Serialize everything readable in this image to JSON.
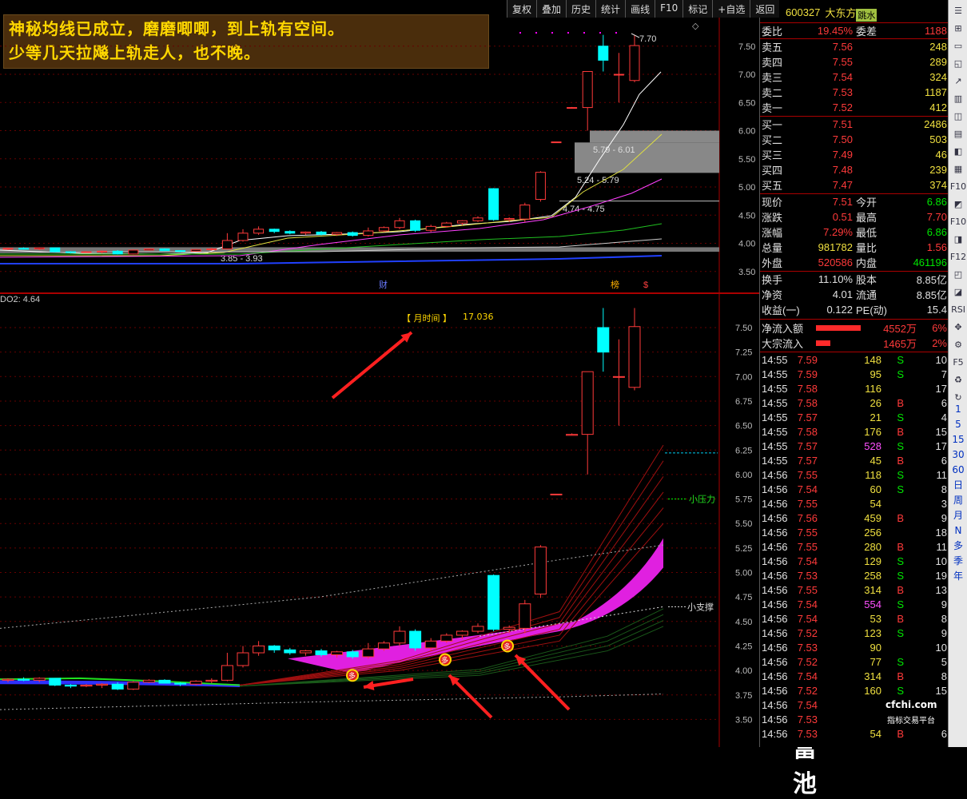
{
  "toolbar": {
    "items": [
      "复权",
      "叠加",
      "历史",
      "统计",
      "画线",
      "F10",
      "标记",
      "+自选",
      "返回"
    ]
  },
  "annotation": {
    "line1": "神秘均线已成立，磨磨唧唧，到上轨有空间。",
    "line2": "少等几天拉飚上轨走人，也不晚。"
  },
  "upper_chart": {
    "y_ticks": [
      "7.50",
      "7.00",
      "6.50",
      "6.00",
      "5.50",
      "5.00",
      "4.50",
      "4.00",
      "3.50"
    ],
    "high_label": "7.70",
    "zone_labels": [
      "5.79 - 6.01",
      "5.24 - 5.79",
      "4.74 - 4.75",
      "3.85 - 3.93"
    ],
    "markers": [
      "财",
      "榜",
      "$"
    ]
  },
  "lower_chart": {
    "indicator": "DO2: 4.64",
    "title": "【 月时间 】",
    "title_value": "17.036",
    "y_ticks": [
      "7.50",
      "7.25",
      "7.00",
      "6.75",
      "6.50",
      "6.25",
      "6.00",
      "5.75",
      "5.50",
      "5.25",
      "5.00",
      "4.75",
      "4.50",
      "4.25",
      "4.00",
      "3.75",
      "3.50"
    ],
    "pressure_label": "小压力",
    "support_label": "小支撑",
    "marker_glyph": "多"
  },
  "quote": {
    "code": "600327",
    "name": "大东方",
    "tag": "跳水",
    "weibi_label": "委比",
    "weibi": "19.45%",
    "weicha_label": "委差",
    "weicha": "1188",
    "sell": [
      {
        "label": "卖五",
        "price": "7.56",
        "vol": "248"
      },
      {
        "label": "卖四",
        "price": "7.55",
        "vol": "289"
      },
      {
        "label": "卖三",
        "price": "7.54",
        "vol": "324"
      },
      {
        "label": "卖二",
        "price": "7.53",
        "vol": "1187"
      },
      {
        "label": "卖一",
        "price": "7.52",
        "vol": "412"
      }
    ],
    "buy": [
      {
        "label": "买一",
        "price": "7.51",
        "vol": "2486"
      },
      {
        "label": "买二",
        "price": "7.50",
        "vol": "503"
      },
      {
        "label": "买三",
        "price": "7.49",
        "vol": "46"
      },
      {
        "label": "买四",
        "price": "7.48",
        "vol": "239"
      },
      {
        "label": "买五",
        "price": "7.47",
        "vol": "374"
      }
    ],
    "stats": [
      {
        "l1": "现价",
        "v1": "7.51",
        "l2": "今开",
        "v2": "6.86",
        "c1": "red",
        "c2": "green"
      },
      {
        "l1": "涨跌",
        "v1": "0.51",
        "l2": "最高",
        "v2": "7.70",
        "c1": "red",
        "c2": "red"
      },
      {
        "l1": "涨幅",
        "v1": "7.29%",
        "l2": "最低",
        "v2": "6.86",
        "c1": "red",
        "c2": "green"
      },
      {
        "l1": "总量",
        "v1": "981782",
        "l2": "量比",
        "v2": "1.56",
        "c1": "yellow",
        "c2": "red"
      },
      {
        "l1": "外盘",
        "v1": "520586",
        "l2": "内盘",
        "v2": "461196",
        "c1": "red",
        "c2": "green"
      }
    ],
    "stats2": [
      {
        "l1": "换手",
        "v1": "11.10%",
        "l2": "股本",
        "v2": "8.85亿"
      },
      {
        "l1": "净资",
        "v1": "4.01",
        "l2": "流通",
        "v2": "8.85亿"
      },
      {
        "l1": "收益(一)",
        "v1": "0.122",
        "l2": "PE(动)",
        "v2": "15.4"
      }
    ],
    "flow": [
      {
        "label": "净流入额",
        "value": "4552万",
        "pct": "6%"
      },
      {
        "label": "大宗流入",
        "value": "1465万",
        "pct": "2%"
      }
    ]
  },
  "ticks": [
    {
      "t": "14:55",
      "p": "7.59",
      "v": "148",
      "s": "S",
      "n": "10"
    },
    {
      "t": "14:55",
      "p": "7.59",
      "v": "95",
      "s": "S",
      "n": "7"
    },
    {
      "t": "14:55",
      "p": "7.58",
      "v": "116",
      "s": "",
      "n": "17"
    },
    {
      "t": "14:55",
      "p": "7.58",
      "v": "26",
      "s": "B",
      "n": "6"
    },
    {
      "t": "14:55",
      "p": "7.57",
      "v": "21",
      "s": "S",
      "n": "4"
    },
    {
      "t": "14:55",
      "p": "7.58",
      "v": "176",
      "s": "B",
      "n": "15"
    },
    {
      "t": "14:55",
      "p": "7.57",
      "v": "528",
      "s": "S",
      "n": "17"
    },
    {
      "t": "14:55",
      "p": "7.57",
      "v": "45",
      "s": "B",
      "n": "6"
    },
    {
      "t": "14:56",
      "p": "7.55",
      "v": "118",
      "s": "S",
      "n": "11"
    },
    {
      "t": "14:56",
      "p": "7.54",
      "v": "60",
      "s": "S",
      "n": "8"
    },
    {
      "t": "14:56",
      "p": "7.55",
      "v": "54",
      "s": "",
      "n": "3"
    },
    {
      "t": "14:56",
      "p": "7.56",
      "v": "459",
      "s": "B",
      "n": "9"
    },
    {
      "t": "14:56",
      "p": "7.55",
      "v": "256",
      "s": "",
      "n": "18"
    },
    {
      "t": "14:56",
      "p": "7.55",
      "v": "280",
      "s": "B",
      "n": "11"
    },
    {
      "t": "14:56",
      "p": "7.54",
      "v": "129",
      "s": "S",
      "n": "10"
    },
    {
      "t": "14:56",
      "p": "7.53",
      "v": "258",
      "s": "S",
      "n": "19"
    },
    {
      "t": "14:56",
      "p": "7.55",
      "v": "314",
      "s": "B",
      "n": "13"
    },
    {
      "t": "14:56",
      "p": "7.54",
      "v": "554",
      "s": "S",
      "n": "9"
    },
    {
      "t": "14:56",
      "p": "7.54",
      "v": "53",
      "s": "B",
      "n": "8"
    },
    {
      "t": "14:56",
      "p": "7.52",
      "v": "123",
      "s": "S",
      "n": "9"
    },
    {
      "t": "14:56",
      "p": "7.53",
      "v": "90",
      "s": "",
      "n": "10"
    },
    {
      "t": "14:56",
      "p": "7.52",
      "v": "77",
      "s": "S",
      "n": "5"
    },
    {
      "t": "14:56",
      "p": "7.54",
      "v": "314",
      "s": "B",
      "n": "8"
    },
    {
      "t": "14:56",
      "p": "7.52",
      "v": "160",
      "s": "S",
      "n": "15"
    },
    {
      "t": "14:56",
      "p": "7.54",
      "v": "",
      "s": "",
      "n": ""
    },
    {
      "t": "14:56",
      "p": "7.53",
      "v": "",
      "s": "",
      "n": ""
    },
    {
      "t": "14:56",
      "p": "7.53",
      "v": "54",
      "s": "B",
      "n": "6"
    }
  ],
  "watermark": {
    "brand": "财富池",
    "site": "cfchi.com",
    "slogan": "指标交易平台"
  },
  "side_icons": [
    "1",
    "5",
    "15",
    "30",
    "60",
    "日",
    "周",
    "月",
    "N",
    "多",
    "季",
    "年"
  ],
  "colors": {
    "up": "#ff3a3a",
    "down": "#00ffff",
    "ma_white": "#ffffff",
    "ma_yellow": "#e0e040",
    "ma_magenta": "#ff40ff",
    "ma_green": "#20c020",
    "ma_blue": "#2040ff"
  }
}
